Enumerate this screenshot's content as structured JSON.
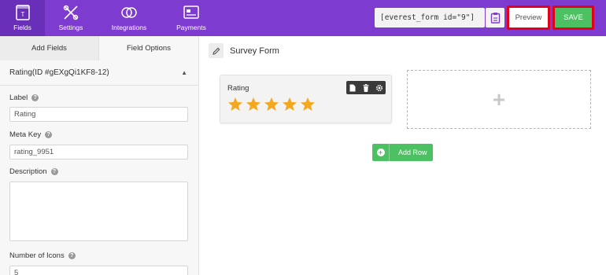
{
  "nav": {
    "items": [
      {
        "label": "Fields",
        "icon": "fields-icon"
      },
      {
        "label": "Settings",
        "icon": "settings-icon"
      },
      {
        "label": "Integrations",
        "icon": "integrations-icon"
      },
      {
        "label": "Payments",
        "icon": "payments-icon"
      }
    ],
    "active": "Fields"
  },
  "header": {
    "shortcode": "[everest_form id=\"9\"]",
    "preview_label": "Preview",
    "save_label": "SAVE"
  },
  "panel": {
    "tabs": [
      {
        "label": "Add Fields"
      },
      {
        "label": "Field Options"
      }
    ],
    "active_tab": "Field Options",
    "field_header": "Rating(ID #gEXgQi1KF8-12)",
    "label_caption": "Label",
    "label_value": "Rating",
    "meta_key_caption": "Meta Key",
    "meta_key_value": "rating_9951",
    "description_caption": "Description",
    "description_value": "",
    "number_of_icons_caption": "Number of Icons",
    "number_of_icons_value": "5"
  },
  "builder": {
    "form_title": "Survey Form",
    "rating_field_label": "Rating",
    "stars": 5,
    "add_row_label": "Add Row"
  },
  "colors": {
    "topbar": "#7e3bd0",
    "accent_green": "#4cc161",
    "highlight_red": "#e3001b",
    "star": "#f4a81d"
  }
}
